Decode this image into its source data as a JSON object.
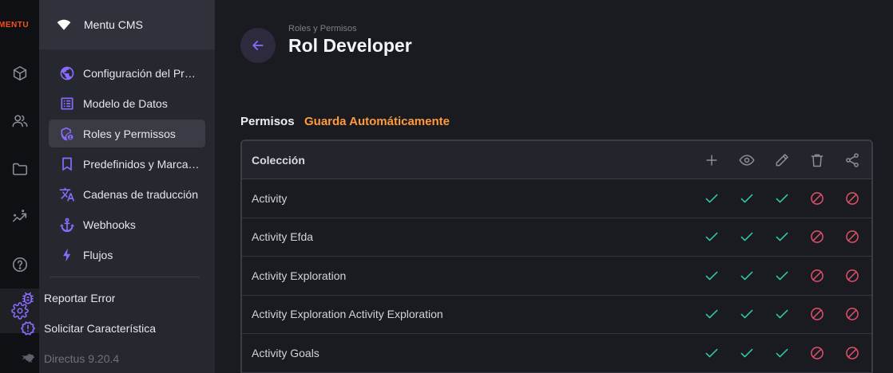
{
  "rail": {
    "logo": "MENTU",
    "icons": [
      "box-icon",
      "users-icon",
      "folder-icon",
      "insights-icon",
      "help-icon",
      "settings-icon"
    ],
    "accent": "#8a6bff"
  },
  "sidebar": {
    "project_name": "Mentu CMS",
    "items": [
      {
        "label": "Configuración del Proyecto",
        "icon": "globe-icon"
      },
      {
        "label": "Modelo de Datos",
        "icon": "list-icon"
      },
      {
        "label": "Roles y Permissos",
        "icon": "shield-user-icon",
        "active": true
      },
      {
        "label": "Predefinidos y Marcadores",
        "icon": "bookmark-icon"
      },
      {
        "label": "Cadenas de traducción",
        "icon": "translate-icon"
      },
      {
        "label": "Webhooks",
        "icon": "anchor-icon"
      },
      {
        "label": "Flujos",
        "icon": "bolt-icon"
      }
    ],
    "footer_items": [
      {
        "label": "Reportar Error",
        "icon": "bug-icon"
      },
      {
        "label": "Solicitar Característica",
        "icon": "new-release-icon"
      }
    ],
    "version": "Directus 9.20.4"
  },
  "header": {
    "breadcrumb": "Roles y Permisos",
    "title": "Rol Developer"
  },
  "permissions": {
    "label": "Permisos",
    "autosave": "Guarda Automáticamente",
    "autosave_color": "#ff9a3d",
    "column_header": "Colección",
    "action_icons": [
      "add-icon",
      "eye-icon",
      "pencil-icon",
      "trash-icon",
      "share-icon"
    ],
    "rows": [
      {
        "name": "Activity",
        "perms": [
          "allow",
          "allow",
          "allow",
          "deny",
          "deny"
        ]
      },
      {
        "name": "Activity Efda",
        "perms": [
          "allow",
          "allow",
          "allow",
          "deny",
          "deny"
        ]
      },
      {
        "name": "Activity Exploration",
        "perms": [
          "allow",
          "allow",
          "allow",
          "deny",
          "deny"
        ]
      },
      {
        "name": "Activity Exploration Activity Exploration",
        "perms": [
          "allow",
          "allow",
          "allow",
          "deny",
          "deny"
        ]
      },
      {
        "name": "Activity Goals",
        "perms": [
          "allow",
          "allow",
          "allow",
          "deny",
          "deny"
        ]
      }
    ],
    "allow_color": "#2ecda7",
    "deny_color": "#e35169"
  }
}
